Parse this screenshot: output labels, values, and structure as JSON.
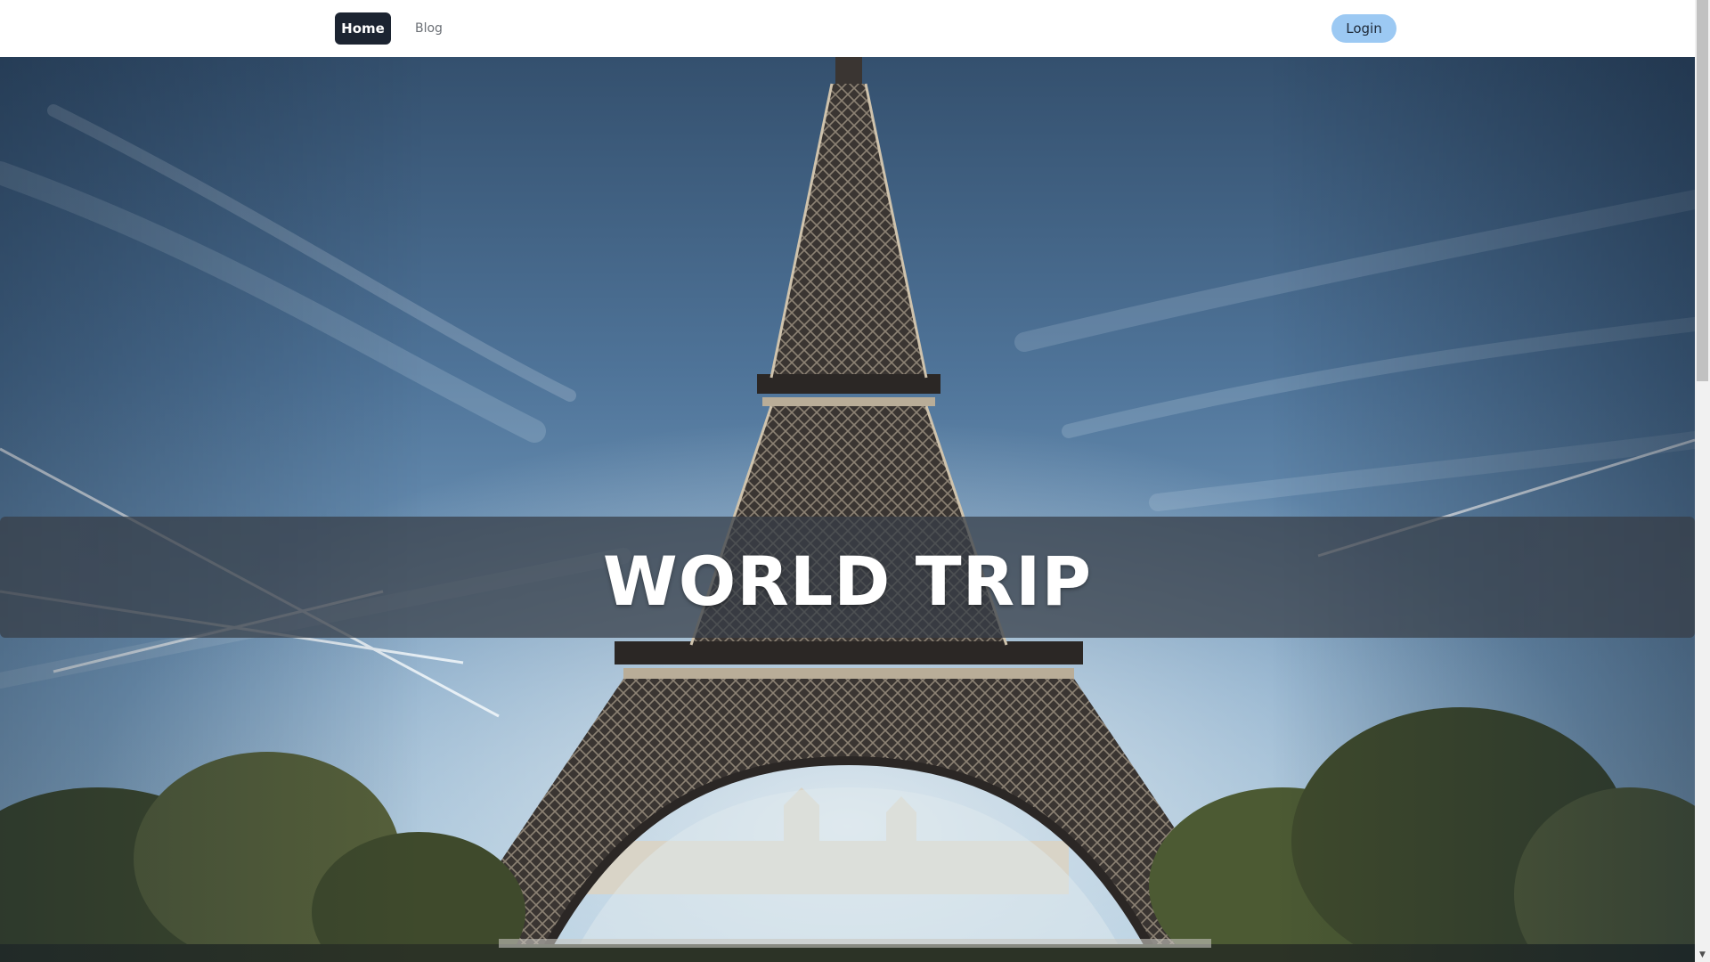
{
  "nav": {
    "home_label": "Home",
    "blog_label": "Blog",
    "login_label": "Login"
  },
  "hero": {
    "title": "WORLD TRIP",
    "image_alt": "Eiffel Tower under a blue sky"
  },
  "scrollbar": {
    "down_arrow": "▼"
  },
  "colors": {
    "home_active_bg": "#1c2431",
    "login_bg": "#9cc9f3",
    "blog_text": "#6b6f75",
    "band_overlay": "rgba(55, 62, 72, 0.74)"
  }
}
